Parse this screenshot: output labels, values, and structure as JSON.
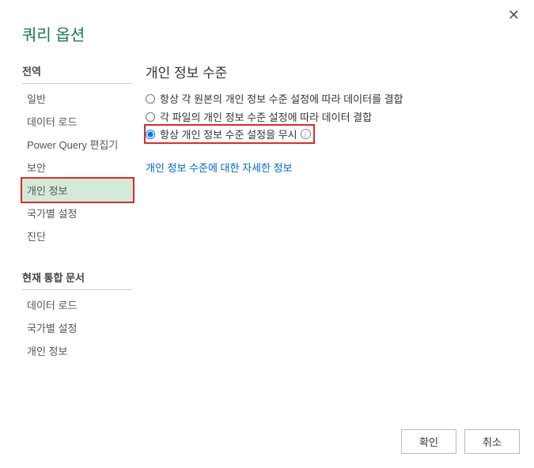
{
  "dialog": {
    "title": "쿼리 옵션"
  },
  "sidebar": {
    "section1": {
      "header": "전역",
      "items": [
        "일반",
        "데이터 로드",
        "Power Query 편집기",
        "보안",
        "개인 정보",
        "국가별 설정",
        "진단"
      ]
    },
    "section2": {
      "header": "현재 통합 문서",
      "items": [
        "데이터 로드",
        "국가별 설정",
        "개인 정보"
      ]
    }
  },
  "content": {
    "title": "개인 정보 수준",
    "radios": [
      "항상 각 원본의 개인 정보 수준 설정에 따라 데이터를 결합",
      "각 파일의 개인 정보 수준 설정에 따라 데이터 결합",
      "항상 개인 정보 수준 설정을 무시"
    ],
    "link": "개인 정보 수준에 대한 자세한 정보"
  },
  "buttons": {
    "ok": "확인",
    "cancel": "취소"
  }
}
